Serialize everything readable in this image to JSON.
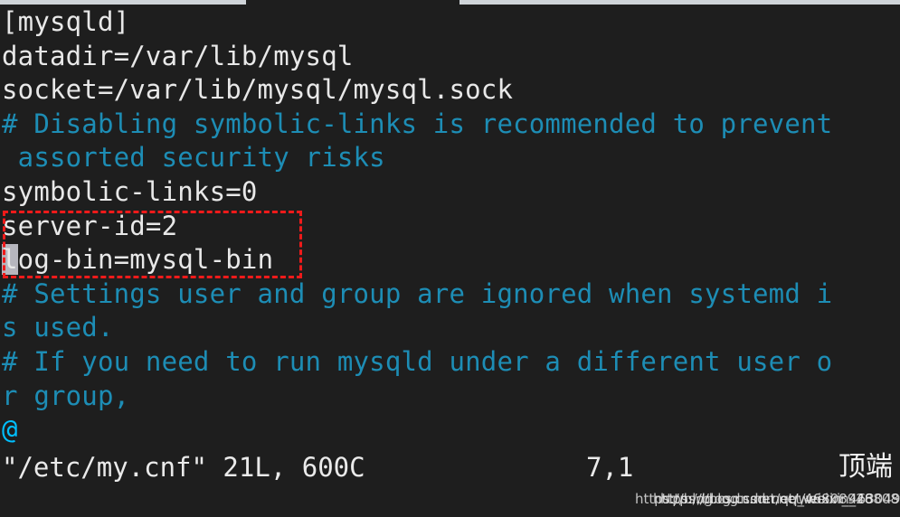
{
  "window": {
    "chrome_strip_color": "#cfd4d8",
    "background_color": "#1e1e1e"
  },
  "terminal": {
    "app": "vim",
    "foreground_color": "#e8e8e8",
    "comment_color": "#1d8db5",
    "at_marker_color": "#00bfff",
    "cursor_color": "#b6b6be",
    "lines": [
      {
        "text": "[mysqld]",
        "kind": "text"
      },
      {
        "text": "datadir=/var/lib/mysql",
        "kind": "text"
      },
      {
        "text": "socket=/var/lib/mysql/mysql.sock",
        "kind": "text"
      },
      {
        "text": "# Disabling symbolic-links is recommended to prevent",
        "kind": "comment"
      },
      {
        "text": " assorted security risks",
        "kind": "comment"
      },
      {
        "text": "symbolic-links=0",
        "kind": "text"
      },
      {
        "text": "server-id=2",
        "kind": "text"
      },
      {
        "text": "log-bin=mysql-bin",
        "kind": "text",
        "cursor_at": 0
      },
      {
        "text": "# Settings user and group are ignored when systemd i",
        "kind": "comment"
      },
      {
        "text": "s used.",
        "kind": "comment"
      },
      {
        "text": "# If you need to run mysqld under a different user o",
        "kind": "comment"
      },
      {
        "text": "r group,",
        "kind": "comment"
      },
      {
        "text": "@",
        "kind": "at"
      }
    ]
  },
  "annotation": {
    "shape": "dashed-rectangle",
    "color": "#ef1a1a",
    "highlights": [
      "server-id=2",
      "log-bin=mysql-bin"
    ]
  },
  "status_line": {
    "file": "\"/etc/my.cnf\" 21L, 600C",
    "ruler": "7,1"
  },
  "overlay": {
    "cjk_label": "顶端",
    "watermarks": [
      "https://blog.csdn.net/qq_46808928",
      "https://blog.csdn.net/weixin_46304923",
      "https://blog.csdn.net/weixin_46808923"
    ]
  }
}
